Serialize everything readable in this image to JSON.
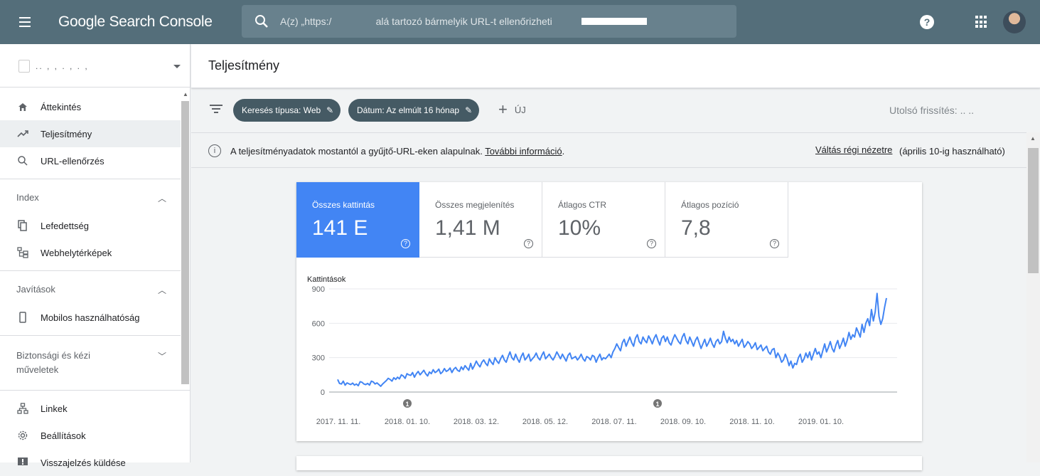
{
  "app": {
    "title": "Google Search Console"
  },
  "search": {
    "placeholder": "A(z) „https:/                alá tartozó bármelyik URL-t ellenőrizheti"
  },
  "property": {
    "name": "..  ,  ,    .  ,  .  ,"
  },
  "nav": {
    "overview": "Áttekintés",
    "performance": "Teljesítmény",
    "url_inspection": "URL-ellenőrzés",
    "index_header": "Index",
    "coverage": "Lefedettség",
    "sitemaps": "Webhelytérképek",
    "enhancements_header": "Javítások",
    "mobile": "Mobilos használhatóság",
    "security_header": "Biztonsági és kézi műveletek",
    "links": "Linkek",
    "settings": "Beállítások",
    "feedback": "Visszajelzés küldése"
  },
  "page": {
    "title": "Teljesítmény"
  },
  "filters": {
    "search_type": "Keresés típusa: Web",
    "date": "Dátum: Az elmúlt 16 hónap",
    "new": "ÚJ",
    "last_update_label": "Utolsó frissítés:",
    "last_update_value": "  .. .."
  },
  "info": {
    "text": "A teljesítményadatok mostantól a gyűjtő-URL-eken alapulnak.",
    "more_link": "További információ",
    "period": ".",
    "switch_link": "Váltás régi nézetre",
    "switch_note": "(április 10-ig használható)"
  },
  "metrics": [
    {
      "label": "Összes kattintás",
      "value": "141 E",
      "active": true
    },
    {
      "label": "Összes megjelenítés",
      "value": "1,41 M",
      "active": false
    },
    {
      "label": "Átlagos CTR",
      "value": "10%",
      "active": false
    },
    {
      "label": "Átlagos pozíció",
      "value": "7,8",
      "active": false
    }
  ],
  "colors": {
    "topbar": "#546e7a",
    "accent": "#4285f4",
    "chip": "#455a64"
  },
  "chart_data": {
    "type": "line",
    "ylabel": "Kattintások",
    "yticks": [
      0,
      300,
      600,
      900
    ],
    "ylim": [
      0,
      900
    ],
    "xticks": [
      "2017. 11. 11.",
      "2018. 01. 10.",
      "2018. 03. 12.",
      "2018. 05. 12.",
      "2018. 07. 11.",
      "2018. 09. 10.",
      "2018. 11. 10.",
      "2019. 01. 10."
    ],
    "annotations": [
      "1",
      "1"
    ],
    "series": [
      {
        "color": "#4285f4",
        "values": [
          110,
          75,
          70,
          95,
          60,
          80,
          72,
          65,
          78,
          60,
          70,
          55,
          90,
          85,
          70,
          65,
          75,
          60,
          95,
          88,
          70,
          80,
          65,
          50,
          70,
          85,
          100,
          120,
          110,
          95,
          125,
          110,
          130,
          115,
          150,
          140,
          120,
          160,
          150,
          145,
          170,
          130,
          160,
          180,
          150,
          170,
          190,
          160,
          140,
          175,
          160,
          195,
          170,
          180,
          200,
          160,
          175,
          205,
          180,
          190,
          210,
          170,
          200,
          215,
          190,
          180,
          220,
          195,
          230,
          210,
          190,
          250,
          200,
          230,
          270,
          240,
          220,
          260,
          280,
          250,
          230,
          290,
          260,
          240,
          300,
          270,
          250,
          290,
          320,
          280,
          260,
          310,
          350,
          300,
          280,
          330,
          290,
          260,
          310,
          340,
          280,
          300,
          330,
          270,
          290,
          310,
          340,
          300,
          280,
          320,
          350,
          290,
          310,
          330,
          300,
          280,
          310,
          350,
          320,
          290,
          330,
          300,
          270,
          320,
          340,
          290,
          300,
          310,
          280,
          300,
          330,
          290,
          270,
          310,
          300,
          280,
          320,
          310,
          260,
          300,
          330,
          280,
          300,
          290,
          310,
          330,
          300,
          350,
          380,
          420,
          390,
          360,
          430,
          460,
          400,
          440,
          480,
          430,
          400,
          470,
          500,
          440,
          420,
          480,
          450,
          430,
          490,
          460,
          420,
          470,
          500,
          450,
          410,
          470,
          490,
          440,
          480,
          430,
          410,
          460,
          500,
          470,
          440,
          420,
          480,
          510,
          450,
          420,
          480,
          440,
          400,
          450,
          480,
          430,
          380,
          420,
          460,
          400,
          430,
          470,
          420,
          390,
          440,
          460,
          420,
          440,
          530,
          470,
          430,
          480,
          440,
          460,
          420,
          450,
          400,
          430,
          460,
          390,
          410,
          440,
          420,
          380,
          400,
          430,
          370,
          390,
          410,
          360,
          380,
          400,
          350,
          330,
          370,
          380,
          300,
          340,
          310,
          260,
          280,
          330,
          290,
          230,
          270,
          210,
          250,
          240,
          300,
          330,
          260,
          290,
          340,
          300,
          350,
          280,
          330,
          380,
          330,
          350,
          300,
          360,
          420,
          350,
          390,
          440,
          380,
          350,
          410,
          450,
          380,
          420,
          470,
          400,
          450,
          520,
          460,
          500,
          480,
          560,
          520,
          480,
          590,
          520,
          600,
          640,
          580,
          720,
          620,
          700,
          860,
          660,
          590,
          640,
          740,
          820
        ]
      }
    ]
  }
}
